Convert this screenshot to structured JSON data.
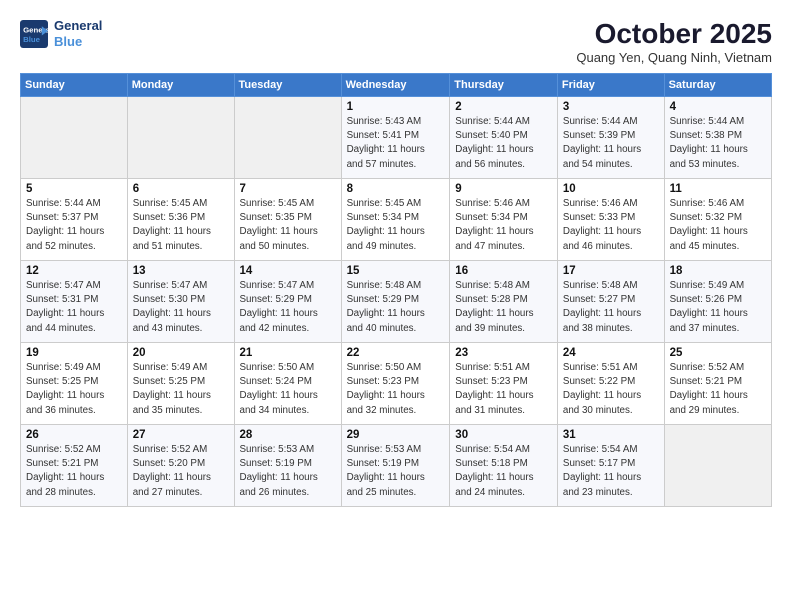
{
  "header": {
    "logo_line1": "General",
    "logo_line2": "Blue",
    "month_title": "October 2025",
    "location": "Quang Yen, Quang Ninh, Vietnam"
  },
  "weekdays": [
    "Sunday",
    "Monday",
    "Tuesday",
    "Wednesday",
    "Thursday",
    "Friday",
    "Saturday"
  ],
  "weeks": [
    [
      {
        "num": "",
        "info": ""
      },
      {
        "num": "",
        "info": ""
      },
      {
        "num": "",
        "info": ""
      },
      {
        "num": "1",
        "info": "Sunrise: 5:43 AM\nSunset: 5:41 PM\nDaylight: 11 hours\nand 57 minutes."
      },
      {
        "num": "2",
        "info": "Sunrise: 5:44 AM\nSunset: 5:40 PM\nDaylight: 11 hours\nand 56 minutes."
      },
      {
        "num": "3",
        "info": "Sunrise: 5:44 AM\nSunset: 5:39 PM\nDaylight: 11 hours\nand 54 minutes."
      },
      {
        "num": "4",
        "info": "Sunrise: 5:44 AM\nSunset: 5:38 PM\nDaylight: 11 hours\nand 53 minutes."
      }
    ],
    [
      {
        "num": "5",
        "info": "Sunrise: 5:44 AM\nSunset: 5:37 PM\nDaylight: 11 hours\nand 52 minutes."
      },
      {
        "num": "6",
        "info": "Sunrise: 5:45 AM\nSunset: 5:36 PM\nDaylight: 11 hours\nand 51 minutes."
      },
      {
        "num": "7",
        "info": "Sunrise: 5:45 AM\nSunset: 5:35 PM\nDaylight: 11 hours\nand 50 minutes."
      },
      {
        "num": "8",
        "info": "Sunrise: 5:45 AM\nSunset: 5:34 PM\nDaylight: 11 hours\nand 49 minutes."
      },
      {
        "num": "9",
        "info": "Sunrise: 5:46 AM\nSunset: 5:34 PM\nDaylight: 11 hours\nand 47 minutes."
      },
      {
        "num": "10",
        "info": "Sunrise: 5:46 AM\nSunset: 5:33 PM\nDaylight: 11 hours\nand 46 minutes."
      },
      {
        "num": "11",
        "info": "Sunrise: 5:46 AM\nSunset: 5:32 PM\nDaylight: 11 hours\nand 45 minutes."
      }
    ],
    [
      {
        "num": "12",
        "info": "Sunrise: 5:47 AM\nSunset: 5:31 PM\nDaylight: 11 hours\nand 44 minutes."
      },
      {
        "num": "13",
        "info": "Sunrise: 5:47 AM\nSunset: 5:30 PM\nDaylight: 11 hours\nand 43 minutes."
      },
      {
        "num": "14",
        "info": "Sunrise: 5:47 AM\nSunset: 5:29 PM\nDaylight: 11 hours\nand 42 minutes."
      },
      {
        "num": "15",
        "info": "Sunrise: 5:48 AM\nSunset: 5:29 PM\nDaylight: 11 hours\nand 40 minutes."
      },
      {
        "num": "16",
        "info": "Sunrise: 5:48 AM\nSunset: 5:28 PM\nDaylight: 11 hours\nand 39 minutes."
      },
      {
        "num": "17",
        "info": "Sunrise: 5:48 AM\nSunset: 5:27 PM\nDaylight: 11 hours\nand 38 minutes."
      },
      {
        "num": "18",
        "info": "Sunrise: 5:49 AM\nSunset: 5:26 PM\nDaylight: 11 hours\nand 37 minutes."
      }
    ],
    [
      {
        "num": "19",
        "info": "Sunrise: 5:49 AM\nSunset: 5:25 PM\nDaylight: 11 hours\nand 36 minutes."
      },
      {
        "num": "20",
        "info": "Sunrise: 5:49 AM\nSunset: 5:25 PM\nDaylight: 11 hours\nand 35 minutes."
      },
      {
        "num": "21",
        "info": "Sunrise: 5:50 AM\nSunset: 5:24 PM\nDaylight: 11 hours\nand 34 minutes."
      },
      {
        "num": "22",
        "info": "Sunrise: 5:50 AM\nSunset: 5:23 PM\nDaylight: 11 hours\nand 32 minutes."
      },
      {
        "num": "23",
        "info": "Sunrise: 5:51 AM\nSunset: 5:23 PM\nDaylight: 11 hours\nand 31 minutes."
      },
      {
        "num": "24",
        "info": "Sunrise: 5:51 AM\nSunset: 5:22 PM\nDaylight: 11 hours\nand 30 minutes."
      },
      {
        "num": "25",
        "info": "Sunrise: 5:52 AM\nSunset: 5:21 PM\nDaylight: 11 hours\nand 29 minutes."
      }
    ],
    [
      {
        "num": "26",
        "info": "Sunrise: 5:52 AM\nSunset: 5:21 PM\nDaylight: 11 hours\nand 28 minutes."
      },
      {
        "num": "27",
        "info": "Sunrise: 5:52 AM\nSunset: 5:20 PM\nDaylight: 11 hours\nand 27 minutes."
      },
      {
        "num": "28",
        "info": "Sunrise: 5:53 AM\nSunset: 5:19 PM\nDaylight: 11 hours\nand 26 minutes."
      },
      {
        "num": "29",
        "info": "Sunrise: 5:53 AM\nSunset: 5:19 PM\nDaylight: 11 hours\nand 25 minutes."
      },
      {
        "num": "30",
        "info": "Sunrise: 5:54 AM\nSunset: 5:18 PM\nDaylight: 11 hours\nand 24 minutes."
      },
      {
        "num": "31",
        "info": "Sunrise: 5:54 AM\nSunset: 5:17 PM\nDaylight: 11 hours\nand 23 minutes."
      },
      {
        "num": "",
        "info": ""
      }
    ]
  ]
}
